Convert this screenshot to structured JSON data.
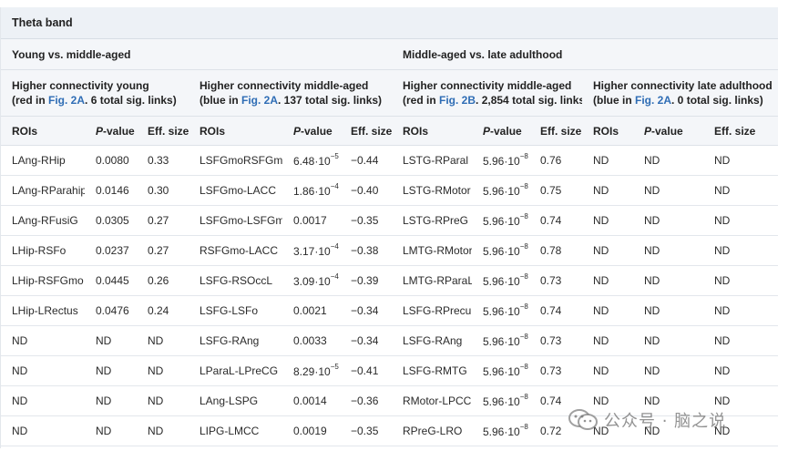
{
  "band_title": "Theta band",
  "comparisons": {
    "left": "Young vs. middle-aged",
    "right": "Middle-aged vs. late adulthood"
  },
  "groups": [
    {
      "title": "Higher connectivity young",
      "prefix": "(red in ",
      "fig": "Fig. 2A",
      "suffix": ". 6 total sig. links)"
    },
    {
      "title": "Higher connectivity middle-aged",
      "prefix": "(blue in ",
      "fig": "Fig. 2A",
      "suffix": ". 137 total sig. links)"
    },
    {
      "title": "Higher connectivity middle-aged",
      "prefix": "(red in ",
      "fig": "Fig. 2B",
      "suffix": ". 2,854 total sig. links)"
    },
    {
      "title": "Higher connectivity late adulthood",
      "prefix": "(blue in ",
      "fig": "Fig. 2A",
      "suffix": ". 0 total sig. links)"
    }
  ],
  "headers": {
    "rois": "ROIs",
    "p": "P",
    "p_suffix": "-value",
    "eff": "Eff. size"
  },
  "rows": [
    {
      "c": [
        [
          "LAng-RHip",
          "0.0080",
          "0.33"
        ],
        [
          "LSFGmoRSFGmo",
          "6.48·10",
          "−5",
          "−0.44"
        ],
        [
          "LSTG-RParal",
          "5.96·10",
          "−8",
          "0.76"
        ],
        [
          "ND",
          "ND",
          "ND"
        ]
      ]
    },
    {
      "c": [
        [
          "LAng-RParahip",
          "0.0146",
          "0.30"
        ],
        [
          "LSFGmo-LACC",
          "1.86·10",
          "−4",
          "−0.40"
        ],
        [
          "LSTG-RMotor",
          "5.96·10",
          "−8",
          "0.75"
        ],
        [
          "ND",
          "ND",
          "ND"
        ]
      ]
    },
    {
      "c": [
        [
          "LAng-RFusiG",
          "0.0305",
          "0.27"
        ],
        [
          "LSFGmo-LSFGm",
          "0.0017",
          "",
          "−0.35"
        ],
        [
          "LSTG-RPreG",
          "5.96·10",
          "−8",
          "0.74"
        ],
        [
          "ND",
          "ND",
          "ND"
        ]
      ]
    },
    {
      "c": [
        [
          "LHip-RSFo",
          "0.0237",
          "0.27"
        ],
        [
          "RSFGmo-LACC",
          "3.17·10",
          "−4",
          "−0.38"
        ],
        [
          "LMTG-RMotor",
          "5.96·10",
          "−8",
          "0.78"
        ],
        [
          "ND",
          "ND",
          "ND"
        ]
      ]
    },
    {
      "c": [
        [
          "LHip-RSFGmo",
          "0.0445",
          "0.26"
        ],
        [
          "LSFG-RSOccL",
          "3.09·10",
          "−4",
          "−0.39"
        ],
        [
          "LMTG-RParaL",
          "5.96·10",
          "−8",
          "0.73"
        ],
        [
          "ND",
          "ND",
          "ND"
        ]
      ]
    },
    {
      "c": [
        [
          "LHip-LRectus",
          "0.0476",
          "0.24"
        ],
        [
          "LSFG-LSFo",
          "0.0021",
          "",
          "−0.34"
        ],
        [
          "LSFG-RPrecu",
          "5.96·10",
          "−8",
          "0.74"
        ],
        [
          "ND",
          "ND",
          "ND"
        ]
      ]
    },
    {
      "c": [
        [
          "ND",
          "ND",
          "ND"
        ],
        [
          "LSFG-RAng",
          "0.0033",
          "",
          "−0.34"
        ],
        [
          "LSFG-RAng",
          "5.96·10",
          "−8",
          "0.73"
        ],
        [
          "ND",
          "ND",
          "ND"
        ]
      ]
    },
    {
      "c": [
        [
          "ND",
          "ND",
          "ND"
        ],
        [
          "LParaL-LPreCG",
          "8.29·10",
          "−5",
          "−0.41"
        ],
        [
          "LSFG-RMTG",
          "5.96·10",
          "−8",
          "0.73"
        ],
        [
          "ND",
          "ND",
          "ND"
        ]
      ]
    },
    {
      "c": [
        [
          "ND",
          "ND",
          "ND"
        ],
        [
          "LAng-LSPG",
          "0.0014",
          "",
          "−0.36"
        ],
        [
          "RMotor-LPCC",
          "5.96·10",
          "−8",
          "0.74"
        ],
        [
          "ND",
          "ND",
          "ND"
        ]
      ]
    },
    {
      "c": [
        [
          "ND",
          "ND",
          "ND"
        ],
        [
          "LIPG-LMCC",
          "0.0019",
          "",
          "−0.35"
        ],
        [
          "RPreG-LRO",
          "5.96·10",
          "−8",
          "0.72"
        ],
        [
          "ND",
          "ND",
          "ND"
        ]
      ]
    }
  ],
  "watermark": {
    "text": "公众号 · 脑之说",
    "icon": "wechat-icon"
  }
}
